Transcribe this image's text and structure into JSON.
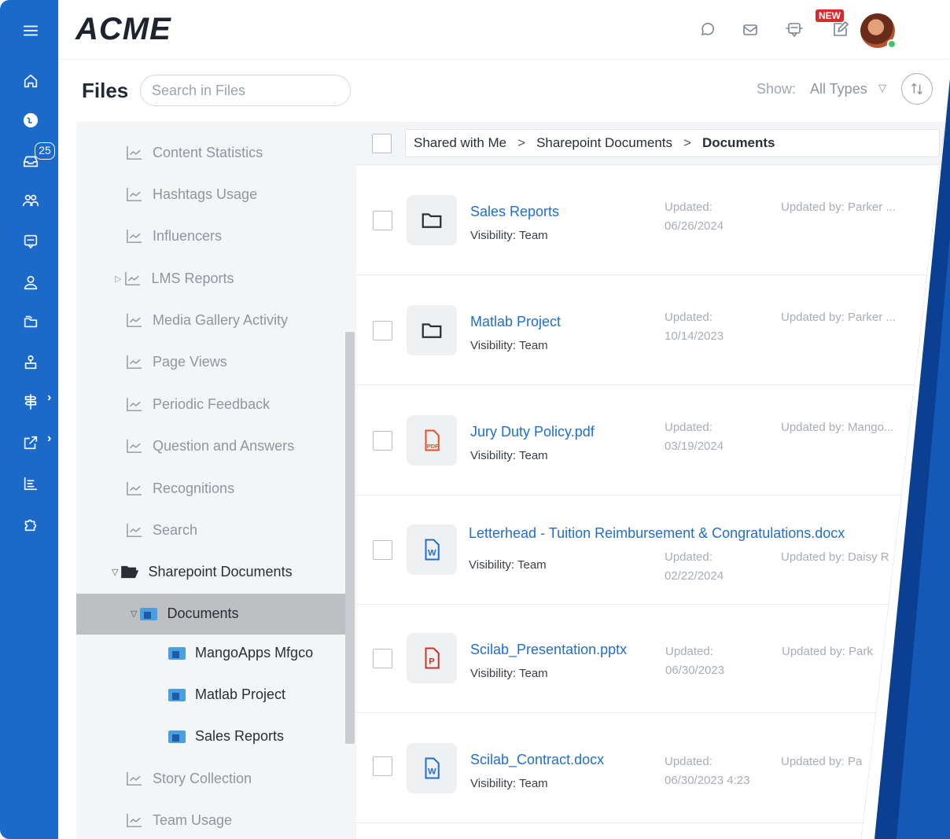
{
  "app": {
    "logo": "ACME"
  },
  "rail": {
    "notification_count": "25"
  },
  "topbar": {
    "new_badge": "NEW"
  },
  "header": {
    "title": "Files",
    "search_placeholder": "Search in Files",
    "show_label": "Show:",
    "show_value": "All Types"
  },
  "tree": {
    "items": [
      "Content Statistics",
      "Hashtags Usage",
      "Influencers",
      "LMS Reports",
      "Media Gallery Activity",
      "Page Views",
      "Periodic Feedback",
      "Question and Answers",
      "Recognitions",
      "Search",
      "Sharepoint Documents",
      "Documents",
      "MangoApps Mfgco",
      "Matlab Project",
      "Sales Reports",
      "Story Collection",
      "Team Usage"
    ]
  },
  "breadcrumb": [
    "Shared with Me",
    "Sharepoint Documents",
    "Documents"
  ],
  "files": [
    {
      "name": "Sales Reports",
      "type": "folder",
      "visibility": "Visibility: Team",
      "updated_label": "Updated:",
      "updated": "06/26/2024",
      "updated_by": "Updated by: Parker ..."
    },
    {
      "name": "Matlab Project",
      "type": "folder",
      "visibility": "Visibility: Team",
      "updated_label": "Updated:",
      "updated": "10/14/2023",
      "updated_by": "Updated by: Parker ..."
    },
    {
      "name": "Jury Duty Policy.pdf",
      "type": "pdf",
      "visibility": "Visibility: Team",
      "updated_label": "Updated:",
      "updated": "03/19/2024",
      "updated_by": "Updated by: Mango..."
    },
    {
      "name": "Letterhead - Tuition Reimbursement & Congratulations.docx",
      "type": "docx",
      "visibility": "Visibility: Team",
      "updated_label": "Updated:",
      "updated": "02/22/2024",
      "updated_by": "Updated by: Daisy R"
    },
    {
      "name": "Scilab_Presentation.pptx",
      "type": "pptx",
      "visibility": "Visibility: Team",
      "updated_label": "Updated:",
      "updated": "06/30/2023",
      "updated_by": "Updated by: Park"
    },
    {
      "name": "Scilab_Contract.docx",
      "type": "docx",
      "visibility": "Visibility: Team",
      "updated_label": "Updated:",
      "updated": "06/30/2023 4:23",
      "updated_by": "Updated by: Pa"
    }
  ],
  "colors": {
    "rail": "#1b6ac9",
    "link": "#1e6fd0",
    "wedge_dark": "#0a3f91",
    "wedge_light": "#1f6fd6",
    "pdf": "#e2502e",
    "pptx": "#c0392b",
    "docx": "#1e6fd0"
  }
}
